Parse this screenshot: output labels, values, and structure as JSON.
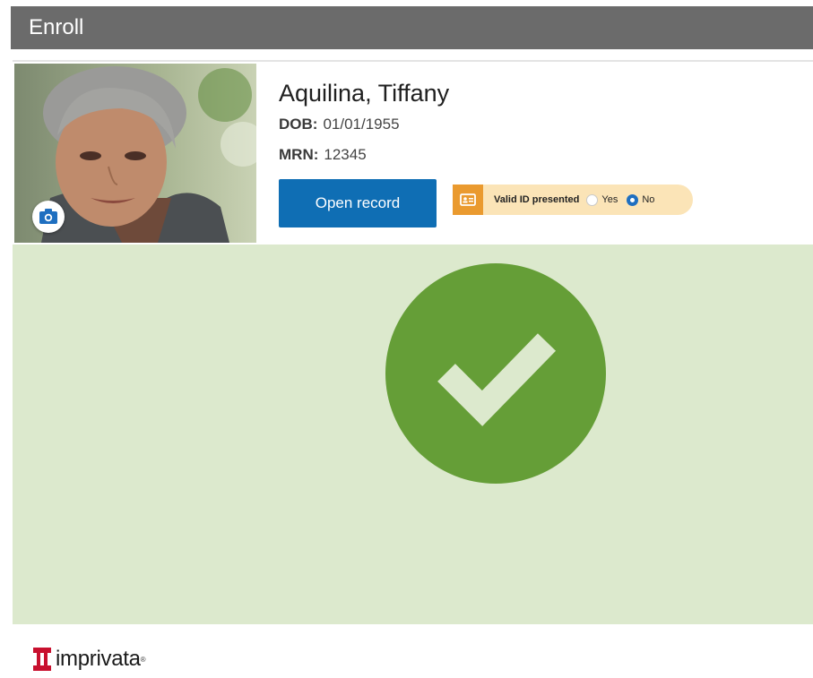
{
  "window": {
    "title": "Enroll"
  },
  "patient": {
    "name": "Aquilina, Tiffany",
    "dob_label": "DOB:",
    "dob": "01/01/1955",
    "mrn_label": "MRN:",
    "mrn": "12345"
  },
  "actions": {
    "open_record_label": "Open record"
  },
  "id_check": {
    "label": "Valid ID presented",
    "options": [
      "Yes",
      "No"
    ],
    "selected": "No"
  },
  "status": {
    "state": "verified",
    "icon": "checkmark-icon"
  },
  "brand": {
    "logo_text": "imprivata",
    "logo_mark": "®"
  },
  "colors": {
    "titlebar": "#6b6b6b",
    "primary_button": "#0f6eb4",
    "id_badge": "#ea9a2f",
    "id_pill": "#fbe4b7",
    "success_bg": "#dce9cd",
    "success_circle": "#659e37",
    "brand_red": "#c8102e"
  }
}
